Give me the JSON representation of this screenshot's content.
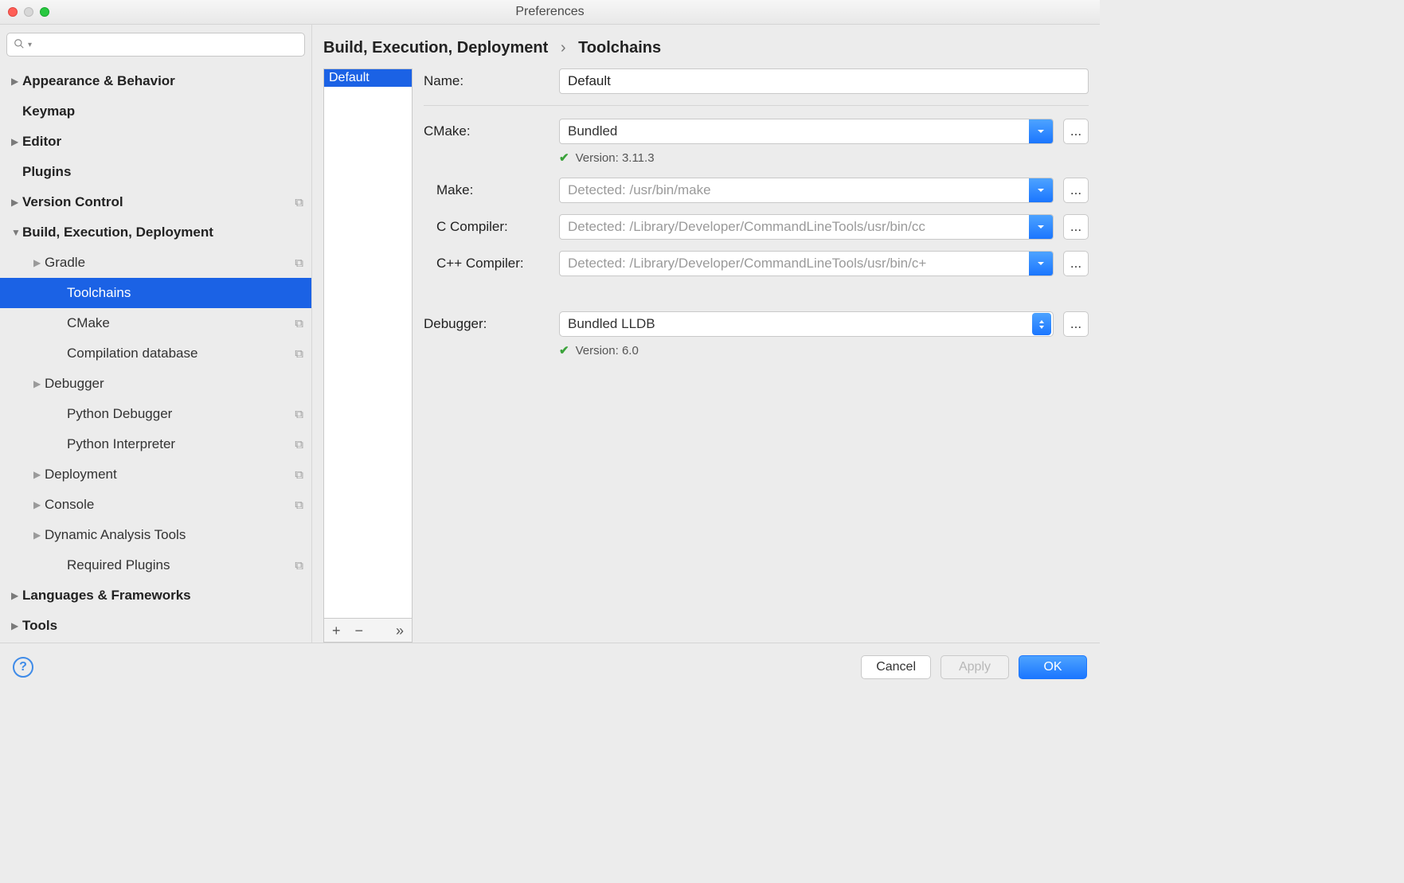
{
  "window": {
    "title": "Preferences"
  },
  "sidebar": {
    "search_placeholder": "",
    "items": [
      {
        "label": "Appearance & Behavior",
        "bold": true,
        "arrow": "right"
      },
      {
        "label": "Keymap",
        "bold": true
      },
      {
        "label": "Editor",
        "bold": true,
        "arrow": "right"
      },
      {
        "label": "Plugins",
        "bold": true
      },
      {
        "label": "Version Control",
        "bold": true,
        "arrow": "right",
        "copy": true
      },
      {
        "label": "Build, Execution, Deployment",
        "bold": true,
        "arrow": "down"
      },
      {
        "label": "Gradle",
        "child": true,
        "arrow": "right",
        "copy": true
      },
      {
        "label": "Toolchains",
        "child": true,
        "grandchild": true,
        "selected": true
      },
      {
        "label": "CMake",
        "child": true,
        "grandchild": true,
        "copy": true
      },
      {
        "label": "Compilation database",
        "child": true,
        "grandchild": true,
        "copy": true
      },
      {
        "label": "Debugger",
        "child": true,
        "arrow": "right"
      },
      {
        "label": "Python Debugger",
        "child": true,
        "grandchild": true,
        "copy": true
      },
      {
        "label": "Python Interpreter",
        "child": true,
        "grandchild": true,
        "copy": true
      },
      {
        "label": "Deployment",
        "child": true,
        "arrow": "right",
        "copy": true
      },
      {
        "label": "Console",
        "child": true,
        "arrow": "right",
        "copy": true
      },
      {
        "label": "Dynamic Analysis Tools",
        "child": true,
        "arrow": "right"
      },
      {
        "label": "Required Plugins",
        "child": true,
        "grandchild": true,
        "copy": true
      },
      {
        "label": "Languages & Frameworks",
        "bold": true,
        "arrow": "right"
      },
      {
        "label": "Tools",
        "bold": true,
        "arrow": "right"
      }
    ]
  },
  "breadcrumb": {
    "parent": "Build, Execution, Deployment",
    "current": "Toolchains"
  },
  "toolchains_list": {
    "items": [
      "Default"
    ],
    "selected": "Default",
    "toolbar": {
      "add": "+",
      "remove": "−",
      "more": "»"
    }
  },
  "form": {
    "name_label": "Name:",
    "name_value": "Default",
    "cmake_label": "CMake:",
    "cmake_value": "Bundled",
    "cmake_status": "Version: 3.11.3",
    "make_label": "Make:",
    "make_placeholder": "Detected: /usr/bin/make",
    "cc_label": "C Compiler:",
    "cc_placeholder": "Detected: /Library/Developer/CommandLineTools/usr/bin/cc",
    "cxx_label": "C++ Compiler:",
    "cxx_placeholder": "Detected: /Library/Developer/CommandLineTools/usr/bin/c+",
    "debugger_label": "Debugger:",
    "debugger_value": "Bundled LLDB",
    "debugger_status": "Version: 6.0",
    "browse": "..."
  },
  "footer": {
    "cancel": "Cancel",
    "apply": "Apply",
    "ok": "OK"
  }
}
